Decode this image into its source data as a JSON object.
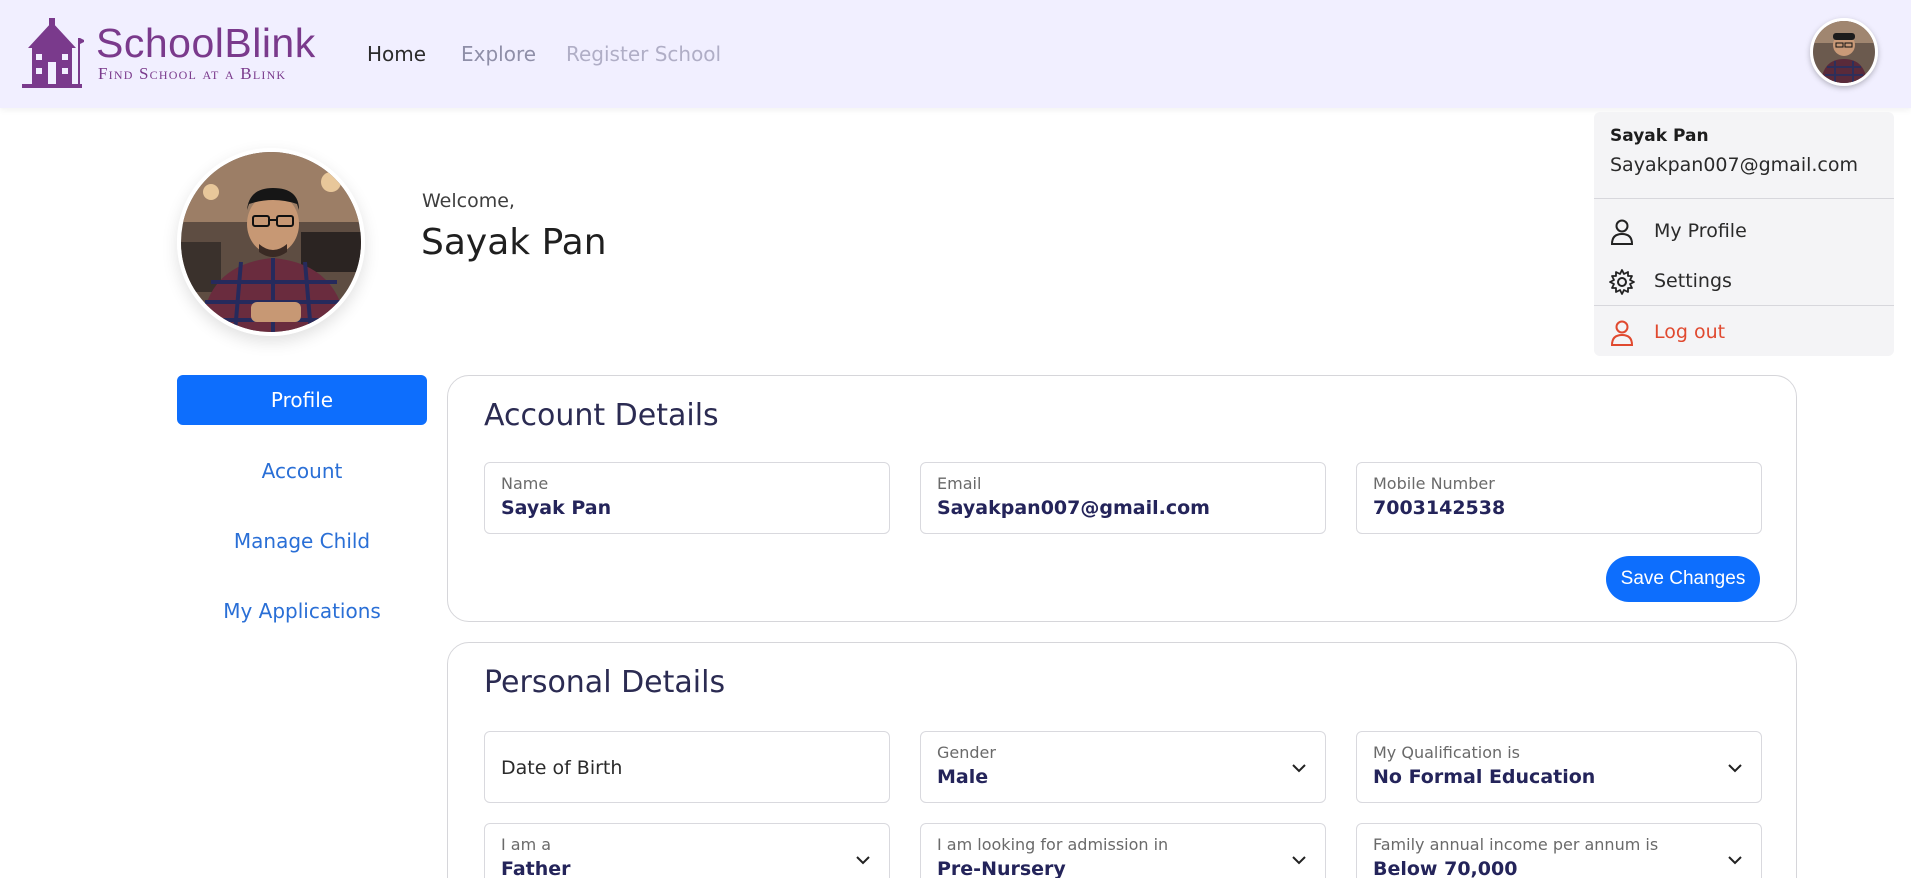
{
  "brand": {
    "name": "SchoolBlink",
    "tagline": "Find School at a Blink"
  },
  "nav": [
    {
      "label": "Home"
    },
    {
      "label": "Explore"
    },
    {
      "label": "Register School"
    }
  ],
  "user_menu": {
    "name": "Sayak Pan",
    "email": "Sayakpan007@gmail.com",
    "items": [
      {
        "label": "My Profile",
        "icon": "user-icon"
      },
      {
        "label": "Settings",
        "icon": "gear-icon"
      },
      {
        "label": "Log out",
        "icon": "logout-user-icon"
      }
    ]
  },
  "profile": {
    "welcome": "Welcome,",
    "name": "Sayak Pan"
  },
  "sidebar": [
    {
      "label": "Profile",
      "active": true
    },
    {
      "label": "Account"
    },
    {
      "label": "Manage Child"
    },
    {
      "label": "My Applications"
    }
  ],
  "account_details": {
    "title": "Account Details",
    "fields": [
      {
        "label": "Name",
        "value": "Sayak Pan"
      },
      {
        "label": "Email",
        "value": "Sayakpan007@gmail.com"
      },
      {
        "label": "Mobile Number",
        "value": "7003142538"
      }
    ],
    "save_label": "Save Changes"
  },
  "personal_details": {
    "title": "Personal Details",
    "fields": [
      {
        "label": "",
        "placeholder": "Date of Birth",
        "value": ""
      },
      {
        "label": "Gender",
        "value": "Male"
      },
      {
        "label": "My Qualification is",
        "value": "No Formal Education"
      },
      {
        "label": "I am a",
        "value": "Father"
      },
      {
        "label": "I am looking for admission in",
        "value": "Pre-Nursery"
      },
      {
        "label": "Family annual income per annum is",
        "value": "Below 70,000"
      }
    ]
  },
  "colors": {
    "primary": "#0d6efd",
    "brand": "#7a3a8c",
    "header_bg": "#f1efff",
    "danger": "#e0492f"
  }
}
